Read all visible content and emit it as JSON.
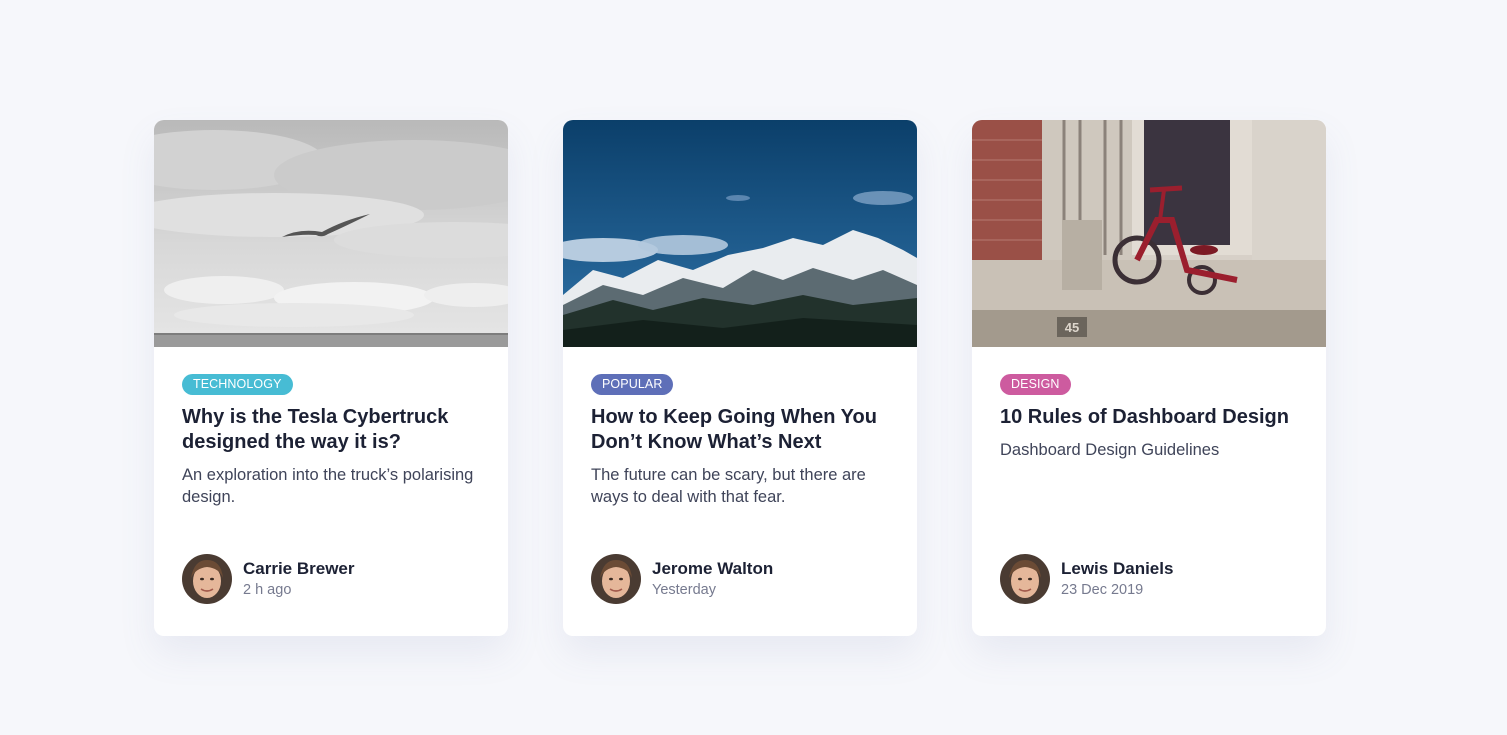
{
  "cards": [
    {
      "tag": "TECHNOLOGY",
      "tag_color": "#47bcd4",
      "image": "seagull-over-sea-photo",
      "title": "Why is the Tesla Cybertruck designed the way it is?",
      "excerpt": "An exploration into the truck’s polarising design.",
      "author": "Carrie Brewer",
      "time": "2 h ago"
    },
    {
      "tag": "POPULAR",
      "tag_color": "#5e6fb8",
      "image": "snowy-mountain-photo",
      "title": "How to Keep Going When You Don’t Know What’s Next",
      "excerpt": "The future can be scary, but there are ways to deal with that fear.",
      "author": "Jerome Walton",
      "time": "Yesterday"
    },
    {
      "tag": "DESIGN",
      "tag_color": "#cd5b9f",
      "image": "red-tricycle-photo",
      "title": "10 Rules of Dashboard Design",
      "excerpt": "Dashboard Design Guidelines",
      "author": "Lewis Daniels",
      "time": "23 Dec 2019",
      "image_text": "45"
    }
  ]
}
